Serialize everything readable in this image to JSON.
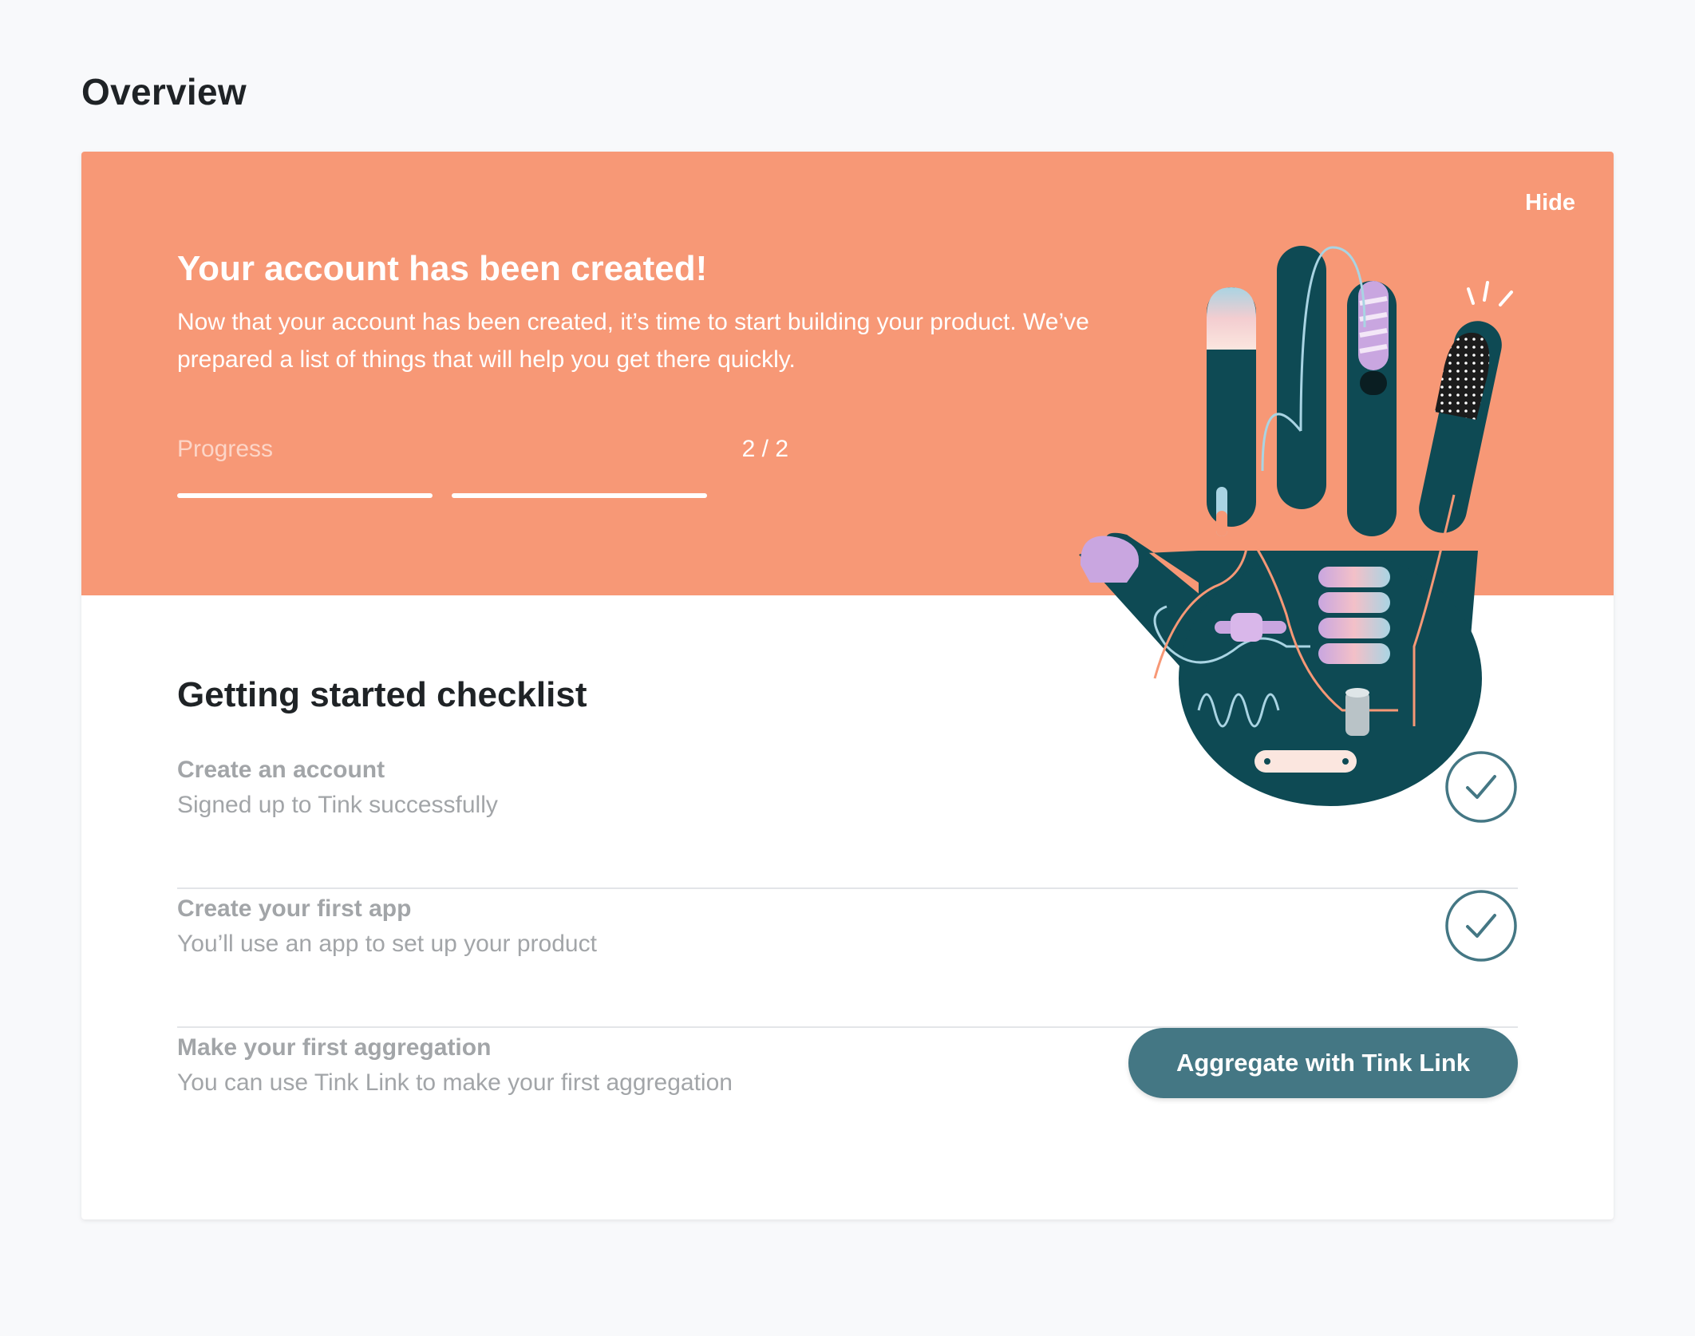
{
  "page": {
    "title": "Overview"
  },
  "banner": {
    "hide_label": "Hide",
    "title": "Your account has been created!",
    "text": "Now that your account has been created, it’s time to start building your product. We’ve prepared a list of things that will help you get there quickly.",
    "progress_label": "Progress",
    "progress_count": "2 / 2",
    "progress_completed": 2,
    "progress_total": 2,
    "background_color": "#f79876"
  },
  "checklist": {
    "title": "Getting started checklist",
    "items": [
      {
        "title": "Create an account",
        "subtitle": "Signed up to Tink successfully",
        "status": "complete",
        "icon": "check-circle-icon"
      },
      {
        "title": "Create your first app",
        "subtitle": "You’ll use an app to set up your product",
        "status": "complete",
        "icon": "check-circle-icon"
      },
      {
        "title": "Make your first aggregation",
        "subtitle": "You can use Tink Link to make your first aggregation",
        "status": "pending",
        "action_label": "Aggregate with Tink Link"
      }
    ]
  },
  "colors": {
    "accent": "#447784",
    "banner": "#f79876",
    "illustration_hand": "#0e4a54"
  }
}
